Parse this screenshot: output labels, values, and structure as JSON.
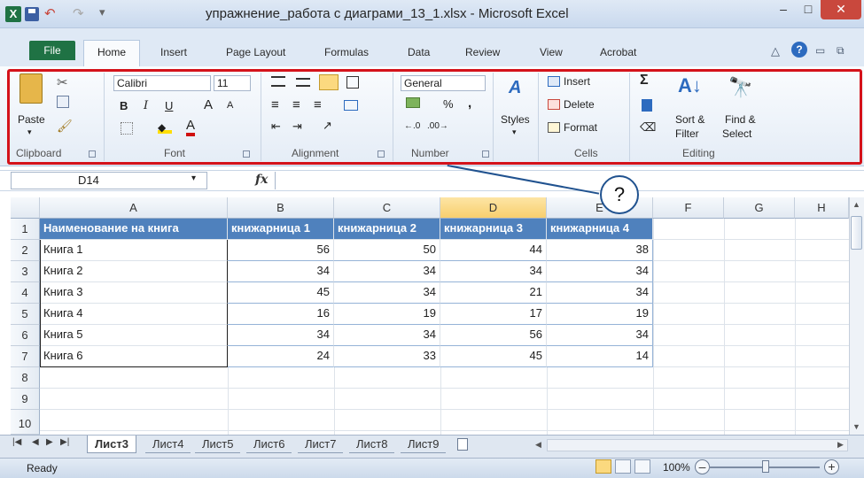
{
  "window": {
    "title": "упражнение_работа с диаграми_13_1.xlsx - Microsoft Excel",
    "app_icon": "X",
    "minimize": "–",
    "maximize": "□",
    "close": "✕"
  },
  "tabs": [
    "File",
    "Home",
    "Insert",
    "Page Layout",
    "Formulas",
    "Data",
    "Review",
    "View",
    "Acrobat"
  ],
  "ribbon": {
    "clipboard": {
      "paste": "Paste",
      "label": "Clipboard"
    },
    "font": {
      "name": "Calibri",
      "size": "11",
      "bold": "B",
      "italic": "I",
      "underline": "U",
      "grow": "A",
      "shrink": "A",
      "color": "A",
      "label": "Font"
    },
    "alignment": {
      "label": "Alignment"
    },
    "number": {
      "format": "General",
      "percent": "%",
      "comma": ",",
      "label": "Number"
    },
    "styles": {
      "label": "Styles"
    },
    "cells": {
      "insert": "Insert",
      "delete": "Delete",
      "format": "Format",
      "label": "Cells"
    },
    "editing": {
      "sum": "Σ",
      "sort": "Sort &",
      "filter": "Filter",
      "find": "Find &",
      "select": "Select",
      "label": "Editing"
    }
  },
  "formula_bar": {
    "name_box": "D14",
    "fx": "fx",
    "value": ""
  },
  "callout": {
    "text": "?"
  },
  "columns": [
    "A",
    "B",
    "C",
    "D",
    "E",
    "F",
    "G",
    "H"
  ],
  "rows": [
    "1",
    "2",
    "3",
    "4",
    "5",
    "6",
    "7",
    "8",
    "9",
    "10"
  ],
  "table": {
    "headers": [
      "Наименование на книга",
      "книжарница 1",
      "книжарница 2",
      "книжарница 3",
      "книжарница 4"
    ],
    "body": [
      [
        "Книга 1",
        "56",
        "50",
        "44",
        "38"
      ],
      [
        "Книга 2",
        "34",
        "34",
        "34",
        "34"
      ],
      [
        "Книга 3",
        "45",
        "34",
        "21",
        "34"
      ],
      [
        "Книга 4",
        "16",
        "19",
        "17",
        "19"
      ],
      [
        "Книга 5",
        "34",
        "34",
        "56",
        "34"
      ],
      [
        "Книга 6",
        "24",
        "33",
        "45",
        "14"
      ]
    ]
  },
  "sheets": [
    "Лист3",
    "Лист4",
    "Лист5",
    "Лист6",
    "Лист7",
    "Лист8",
    "Лист9"
  ],
  "active_sheet": "Лист3",
  "status": {
    "text": "Ready",
    "zoom": "100%",
    "zoom_level_percent": 100
  },
  "colors": {
    "excel_green": "#1f7244",
    "header_fill": "#4f81bd",
    "highlight": "#d4121a",
    "callout": "#20528f"
  }
}
